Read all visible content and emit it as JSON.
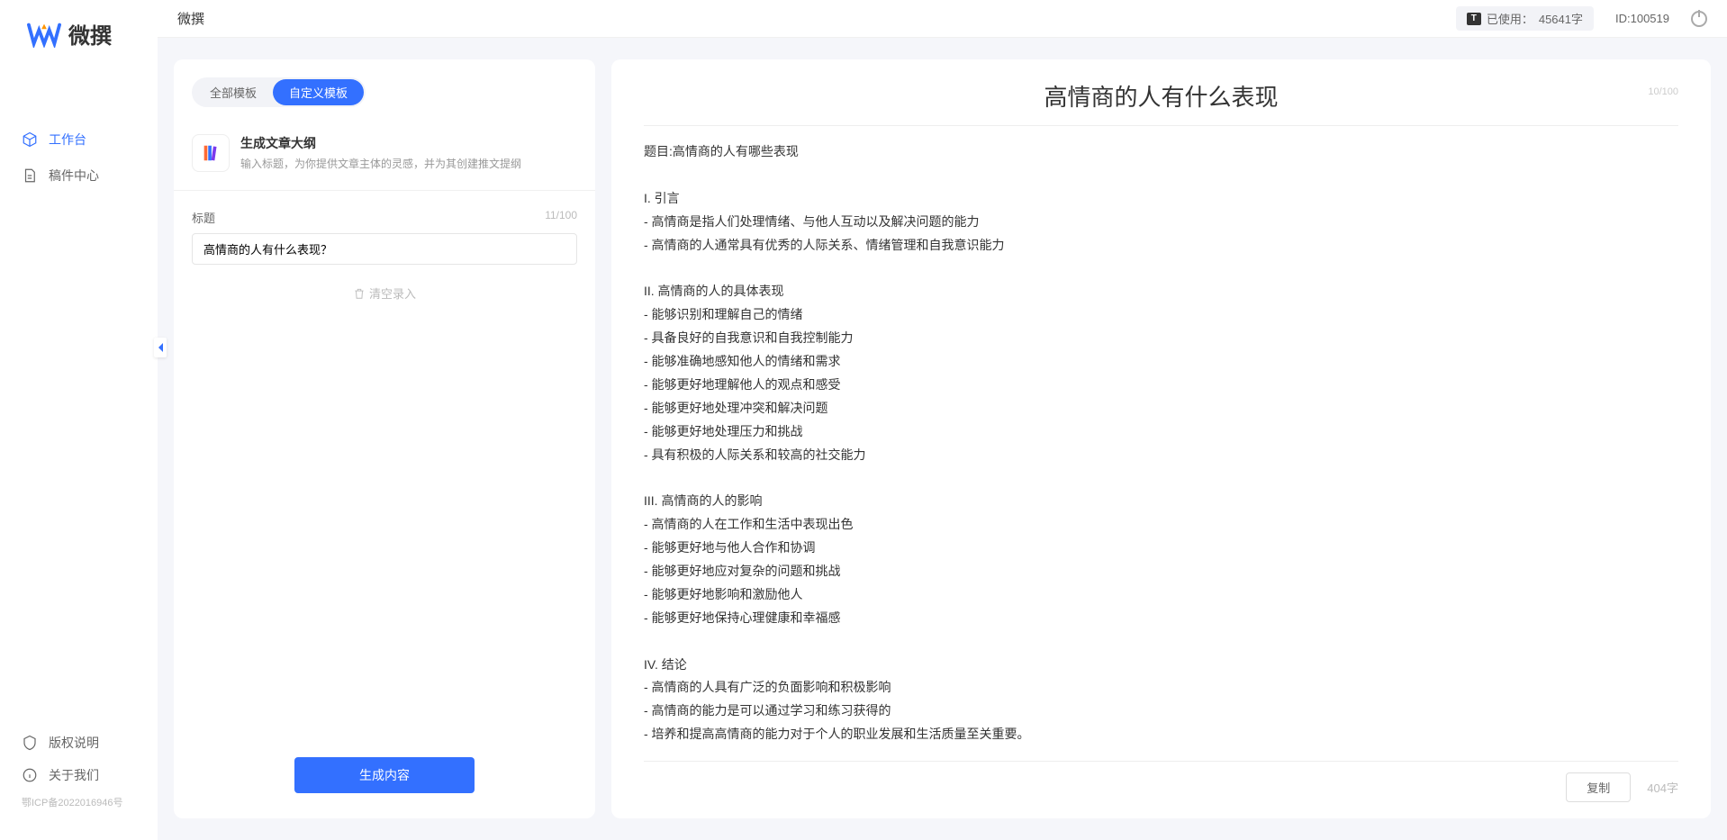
{
  "app": {
    "name": "微撰",
    "logoText": "微撰",
    "topTitle": "微撰"
  },
  "sidebar": {
    "nav": [
      {
        "label": "工作台"
      },
      {
        "label": "稿件中心"
      }
    ],
    "footer": [
      {
        "label": "版权说明"
      },
      {
        "label": "关于我们"
      }
    ],
    "icp": "鄂ICP备2022016946号"
  },
  "topbar": {
    "usagePrefix": "已使用：",
    "usageCount": "45641字",
    "idLabel": "ID:100519"
  },
  "tabs": {
    "all": "全部模板",
    "custom": "自定义模板"
  },
  "template": {
    "title": "生成文章大纲",
    "desc": "输入标题，为你提供文章主体的灵感，并为其创建推文提纲"
  },
  "form": {
    "titleLabel": "标题",
    "titleCount": "11/100",
    "titleValue": "高情商的人有什么表现？",
    "clearLabel": "清空录入",
    "generateLabel": "生成内容"
  },
  "result": {
    "title": "高情商的人有什么表现",
    "counter": "10/100",
    "body": "题目:高情商的人有哪些表现\n\nI. 引言\n- 高情商是指人们处理情绪、与他人互动以及解决问题的能力\n- 高情商的人通常具有优秀的人际关系、情绪管理和自我意识能力\n\nII. 高情商的人的具体表现\n- 能够识别和理解自己的情绪\n- 具备良好的自我意识和自我控制能力\n- 能够准确地感知他人的情绪和需求\n- 能够更好地理解他人的观点和感受\n- 能够更好地处理冲突和解决问题\n- 能够更好地处理压力和挑战\n- 具有积极的人际关系和较高的社交能力\n\nIII. 高情商的人的影响\n- 高情商的人在工作和生活中表现出色\n- 能够更好地与他人合作和协调\n- 能够更好地应对复杂的问题和挑战\n- 能够更好地影响和激励他人\n- 能够更好地保持心理健康和幸福感\n\nIV. 结论\n- 高情商的人具有广泛的负面影响和积极影响\n- 高情商的能力是可以通过学习和练习获得的\n- 培养和提高高情商的能力对于个人的职业发展和生活质量至关重要。",
    "copyLabel": "复制",
    "wordCount": "404字"
  }
}
